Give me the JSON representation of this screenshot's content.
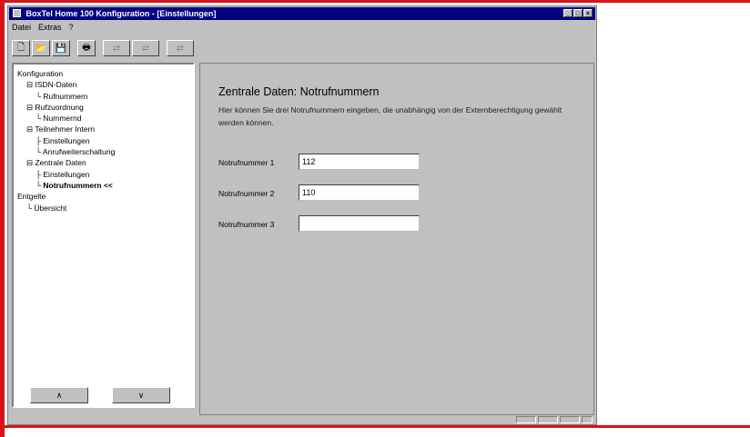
{
  "window": {
    "title": "BoxTel Home 100 Konfiguration - [Einstellungen]"
  },
  "titlebar_buttons": [
    "_",
    "□",
    "×"
  ],
  "menu": [
    "Datei",
    "Extras",
    "?"
  ],
  "toolbar": {
    "new": "🗋",
    "open": "📂",
    "save": "💾",
    "print": "🖶",
    "nav1": "⇄",
    "nav2": "⇄",
    "nav3": "⇄"
  },
  "tree": {
    "root": "Konfiguration",
    "isdn": "ISDN-Daten",
    "rufnummern": "Rufnummern",
    "rufzuordnung": "Rufzuordnung",
    "nummernd": "Nummernd",
    "teilnehmer": "Teilnehmer Intern",
    "einstellungen1": "Einstellungen",
    "anrufweiter": "Anrufweiterschaltung",
    "zentrale": "Zentrale Daten",
    "einstellungen2": "Einstellungen",
    "notrufnummern": "Notrufnummern <<",
    "entgelte": "Entgelte",
    "uebersicht": "Übersicht"
  },
  "nav": {
    "up": "∧",
    "down": "∨"
  },
  "main": {
    "heading": "Zentrale Daten: Notrufnummern",
    "description": "Hier können Sie drei Notrufnummern eingeben, die unabhängig von der Externberechtigung gewählt werden können.",
    "fields": [
      {
        "label": "Notrufnummer 1",
        "value": "112"
      },
      {
        "label": "Notrufnummer 2",
        "value": "110"
      },
      {
        "label": "Notrufnummer 3",
        "value": ""
      }
    ]
  },
  "colors": {
    "accent_red": "#d6141b",
    "titlebar": "#000080",
    "face": "#c0c0c0"
  }
}
